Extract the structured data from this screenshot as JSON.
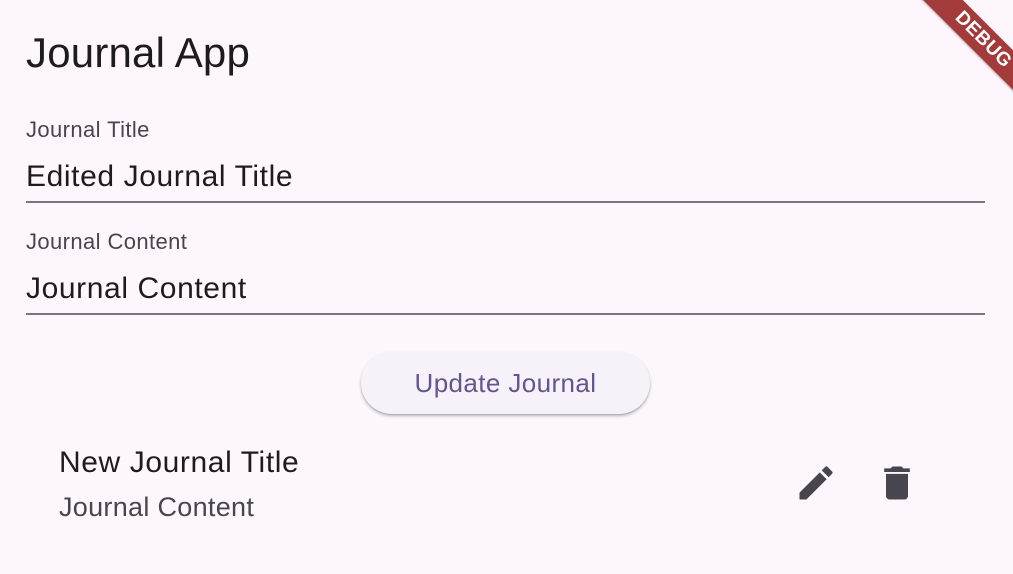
{
  "app": {
    "title": "Journal App"
  },
  "form": {
    "title_label": "Journal Title",
    "title_value": "Edited Journal Title",
    "content_label": "Journal Content",
    "content_value": "Journal Content",
    "update_button_label": "Update Journal"
  },
  "journals": [
    {
      "title": "New Journal Title",
      "content": "Journal Content",
      "edit_icon": "pencil-icon",
      "delete_icon": "trash-icon"
    }
  ],
  "debug_banner": {
    "label": "DEBUG",
    "color": "#a33b3b"
  },
  "colors": {
    "background": "#fdf7fd",
    "primary": "#65558f",
    "on_surface": "#1d1b20",
    "on_surface_variant": "#49454f",
    "outline": "#79747e"
  }
}
